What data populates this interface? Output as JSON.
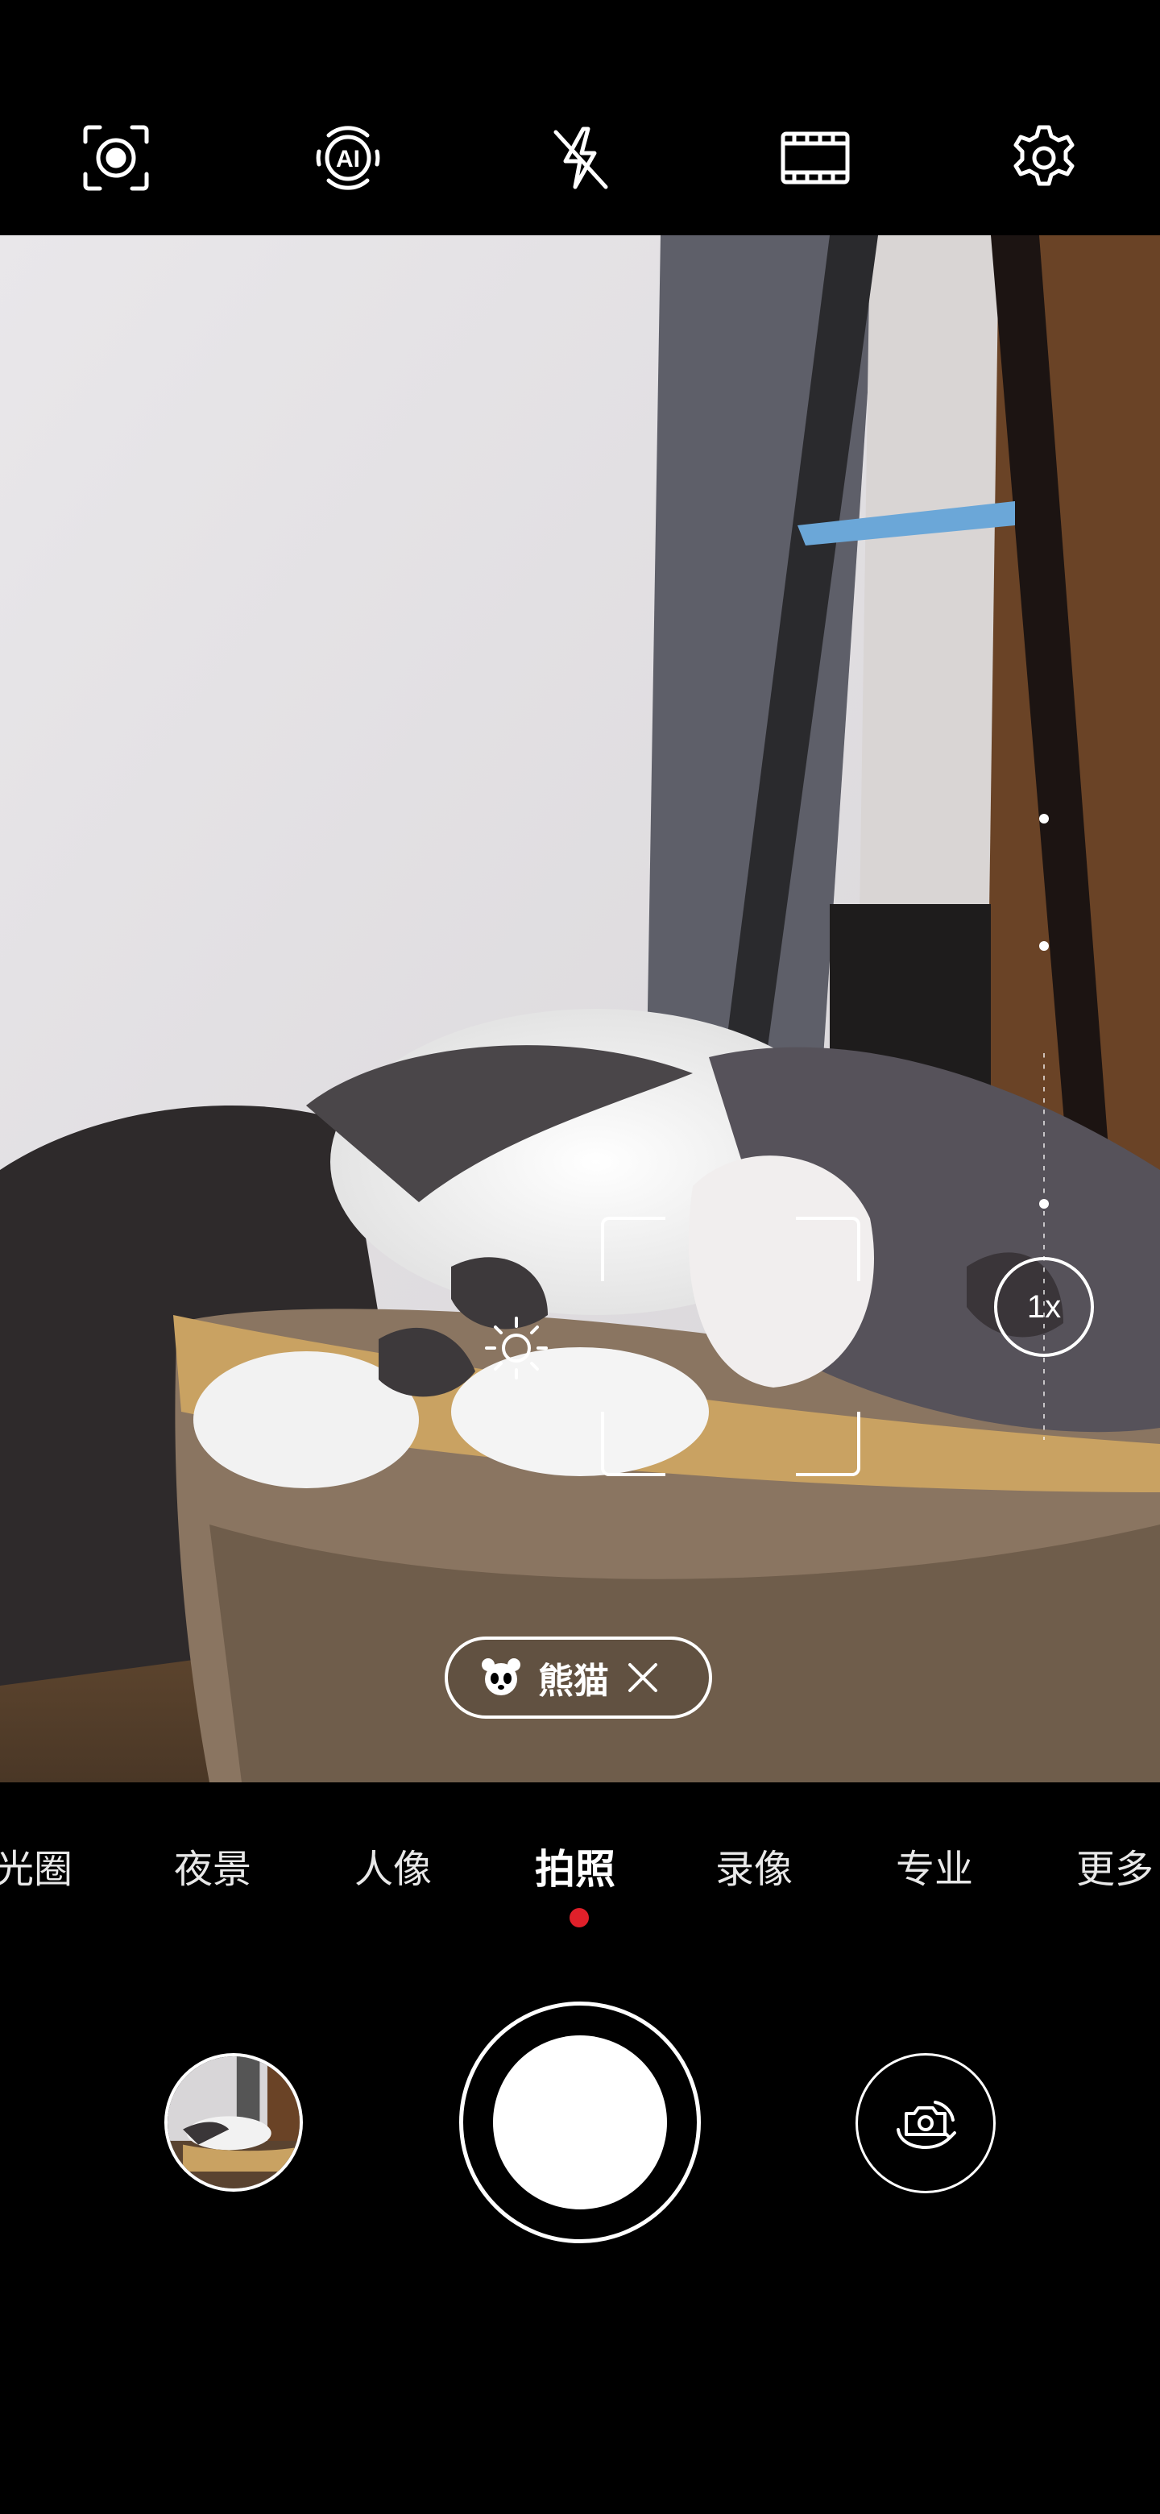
{
  "top_bar": {
    "icons": [
      "smart-capture-icon",
      "ai-icon",
      "flash-off-icon",
      "aspect-ratio-icon",
      "settings-icon"
    ]
  },
  "viewfinder": {
    "zoom_label": "1x",
    "scene_chip": {
      "icon": "panda-icon",
      "label": "熊猫"
    }
  },
  "modes": {
    "items": [
      "光圈",
      "夜景",
      "人像",
      "拍照",
      "录像",
      "专业",
      "更多"
    ],
    "active": "拍照",
    "accent_color": "#e0202a"
  },
  "bottom": {
    "gallery": "gallery-thumbnail",
    "shutter": "shutter-button",
    "switch": "switch-camera-icon"
  }
}
